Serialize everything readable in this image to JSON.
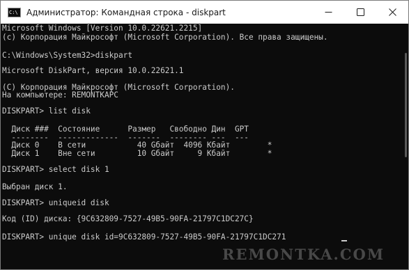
{
  "window": {
    "title": "Администратор: Командная строка - diskpart",
    "icon_label": "C:\\"
  },
  "terminal": {
    "lines": [
      "Microsoft Windows [Version 10.0.22621.2215]",
      "(c) Корпорация Майкрософт (Microsoft Corporation). Все права защищены.",
      "",
      "C:\\Windows\\System32>diskpart",
      "",
      "Microsoft DiskPart, версия 10.0.22621.1",
      "",
      "(C) Корпорация Майкрософт (Microsoft Corporation).",
      "На компьютере: REMONTKAPC",
      "",
      "DISKPART> list disk",
      "",
      "  Диск ###  Состояние      Размер   Свободно Дин  GPT",
      "  --------  -------------  -------  -------- ---  ---",
      "  Диск 0    В сети           40 Gбайт  4096 Kбайт        *",
      "  Диск 1    Вне сети         10 Gбайт     9 Kбайт        *",
      "",
      "DISKPART> select disk 1",
      "",
      "Выбран диск 1.",
      "",
      "DISKPART> uniqueid disk",
      "",
      "Код (ID) диска: {9C632809-7527-49B5-90FA-21797C1DC27C}",
      "",
      "DISKPART> unique disk id=9C632809-7527-49B5-90FA-21797C1DC271"
    ]
  },
  "watermark": "REMONTKA.COM",
  "colors": {
    "terminal_bg": "#0c0c0c",
    "terminal_text": "#cccccc",
    "titlebar_bg": "#ffffff"
  },
  "icons": {
    "minimize": "minimize-icon",
    "maximize": "maximize-icon",
    "close": "close-icon"
  }
}
